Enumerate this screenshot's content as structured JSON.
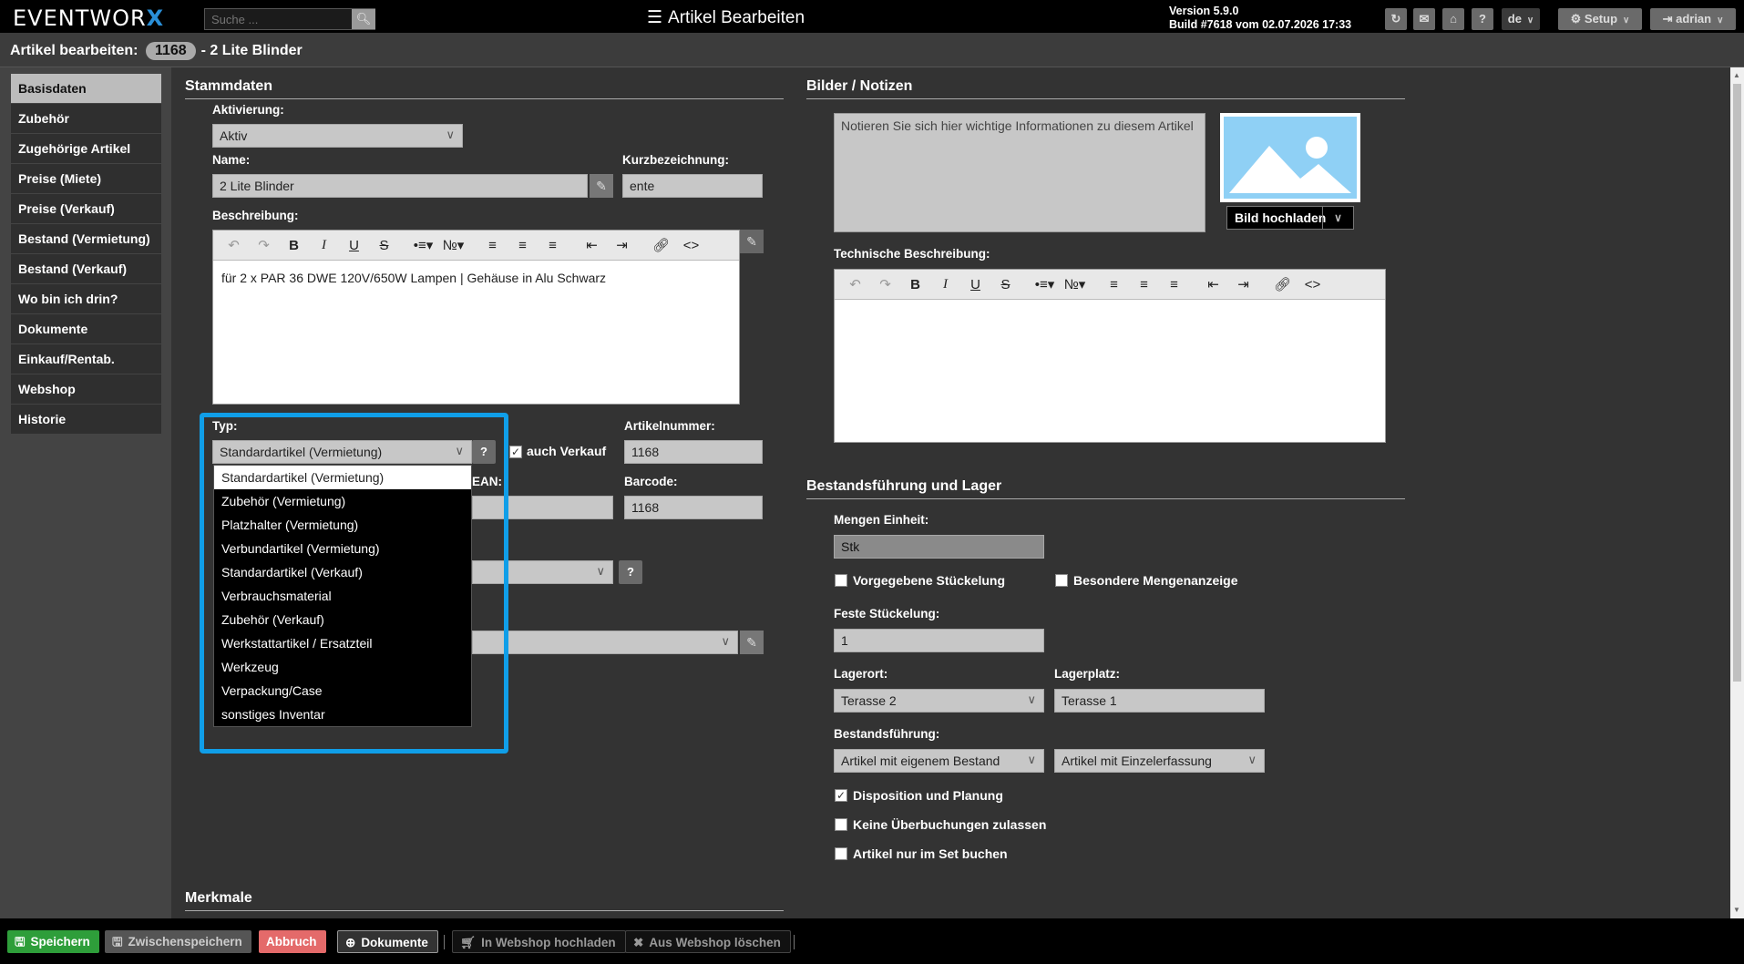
{
  "topbar": {
    "logo_text": "EVENTWOR",
    "logo_x": "X",
    "search_placeholder": "Suche ...",
    "title": "Artikel Bearbeiten",
    "version_line1": "Version 5.9.0",
    "version_line2": "Build #7618 vom 02.07.2026 17:33",
    "lang": "de",
    "setup_label": "Setup",
    "user_label": "adrian",
    "help_label": "?"
  },
  "page_header": {
    "label": "Artikel bearbeiten:",
    "article_no": "1168",
    "article_name": "- 2 Lite Blinder"
  },
  "sidebar": {
    "items": [
      {
        "label": "Basisdaten"
      },
      {
        "label": "Zubehör"
      },
      {
        "label": "Zugehörige Artikel"
      },
      {
        "label": "Preise (Miete)"
      },
      {
        "label": "Preise (Verkauf)"
      },
      {
        "label": "Bestand (Vermietung)"
      },
      {
        "label": "Bestand (Verkauf)"
      },
      {
        "label": "Wo bin ich drin?"
      },
      {
        "label": "Dokumente"
      },
      {
        "label": "Einkauf/Rentab."
      },
      {
        "label": "Webshop"
      },
      {
        "label": "Historie"
      }
    ]
  },
  "stammdaten": {
    "title": "Stammdaten",
    "aktivierung_label": "Aktivierung:",
    "aktivierung_value": "Aktiv",
    "name_label": "Name:",
    "name_value": "2 Lite Blinder",
    "kurz_label": "Kurzbezeichnung:",
    "kurz_value": "ente",
    "beschreibung_label": "Beschreibung:",
    "beschreibung_text": "für 2 x PAR 36 DWE 120V/650W Lampen | Gehäuse in Alu Schwarz",
    "typ_label": "Typ:",
    "typ_value": "Standardartikel (Vermietung)",
    "auch_verkauf_label": "auch Verkauf",
    "artikelnummer_label": "Artikelnummer:",
    "artikelnummer_value": "1168",
    "ean_label": "EAN:",
    "barcode_label": "Barcode:",
    "barcode_value": "1168",
    "help_label": "?"
  },
  "typ_options": [
    "Standardartikel (Vermietung)",
    "Zubehör (Vermietung)",
    "Platzhalter (Vermietung)",
    "Verbundartikel (Vermietung)",
    "Standardartikel (Verkauf)",
    "Verbrauchsmaterial",
    "Zubehör (Verkauf)",
    "Werkstattartikel / Ersatzteil",
    "Werkzeug",
    "Verpackung/Case",
    "sonstiges Inventar"
  ],
  "bilder": {
    "title": "Bilder / Notizen",
    "notes_placeholder": "Notieren Sie sich hier wichtige Informationen zu diesem Artikel",
    "upload_label": "Bild hochladen",
    "tech_label": "Technische Beschreibung:"
  },
  "bestand": {
    "title": "Bestandsführung und Lager",
    "einheit_label": "Mengen Einheit:",
    "einheit_value": "Stk",
    "vorgegebene_label": "Vorgegebene Stückelung",
    "besondere_label": "Besondere Mengenanzeige",
    "feste_label": "Feste Stückelung:",
    "feste_value": "1",
    "lagerort_label": "Lagerort:",
    "lagerort_value": "Terasse 2",
    "lagerplatz_label": "Lagerplatz:",
    "lagerplatz_value": "Terasse 1",
    "bestandsfuehrung_label": "Bestandsführung:",
    "bestandsfuehrung_value": "Artikel mit eigenem Bestand",
    "erfassung_value": "Artikel mit Einzelerfassung",
    "disposition_label": "Disposition und Planung",
    "keine_ueber_label": "Keine Überbuchungen zulassen",
    "nur_set_label": "Artikel nur im Set buchen"
  },
  "merkmale": {
    "title": "Merkmale"
  },
  "bottombar": {
    "save": "Speichern",
    "interim": "Zwischenspeichern",
    "cancel": "Abbruch",
    "documents": "Dokumente",
    "webshop_upload": "In Webshop hochladen",
    "webshop_delete": "Aus Webshop löschen"
  },
  "colors": {
    "save_green": "#2e9e3a",
    "cancel_red": "#e46a6a",
    "highlight_blue": "#109ee8",
    "logo_blue": "#2a8fd8"
  }
}
